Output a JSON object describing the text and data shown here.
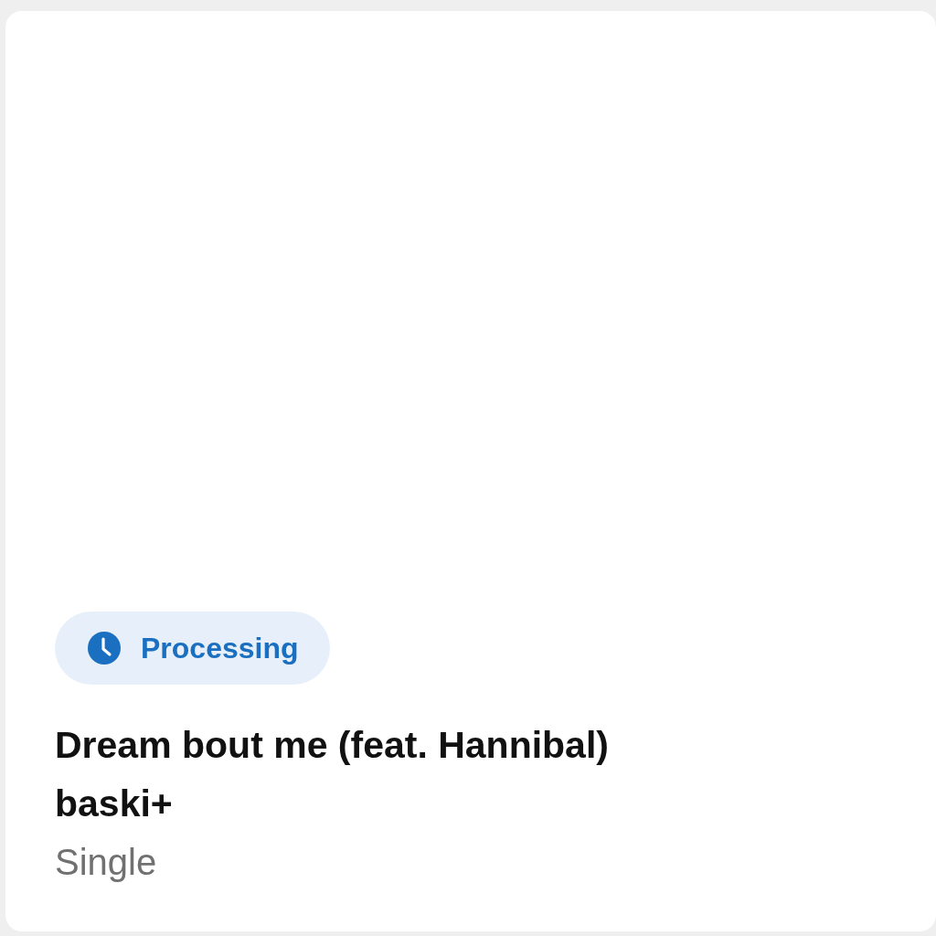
{
  "status": {
    "kind": "processing",
    "label": "Processing"
  },
  "release": {
    "title": "Dream bout me (feat. Hannibal)",
    "artist": "baski+",
    "type": "Single"
  }
}
